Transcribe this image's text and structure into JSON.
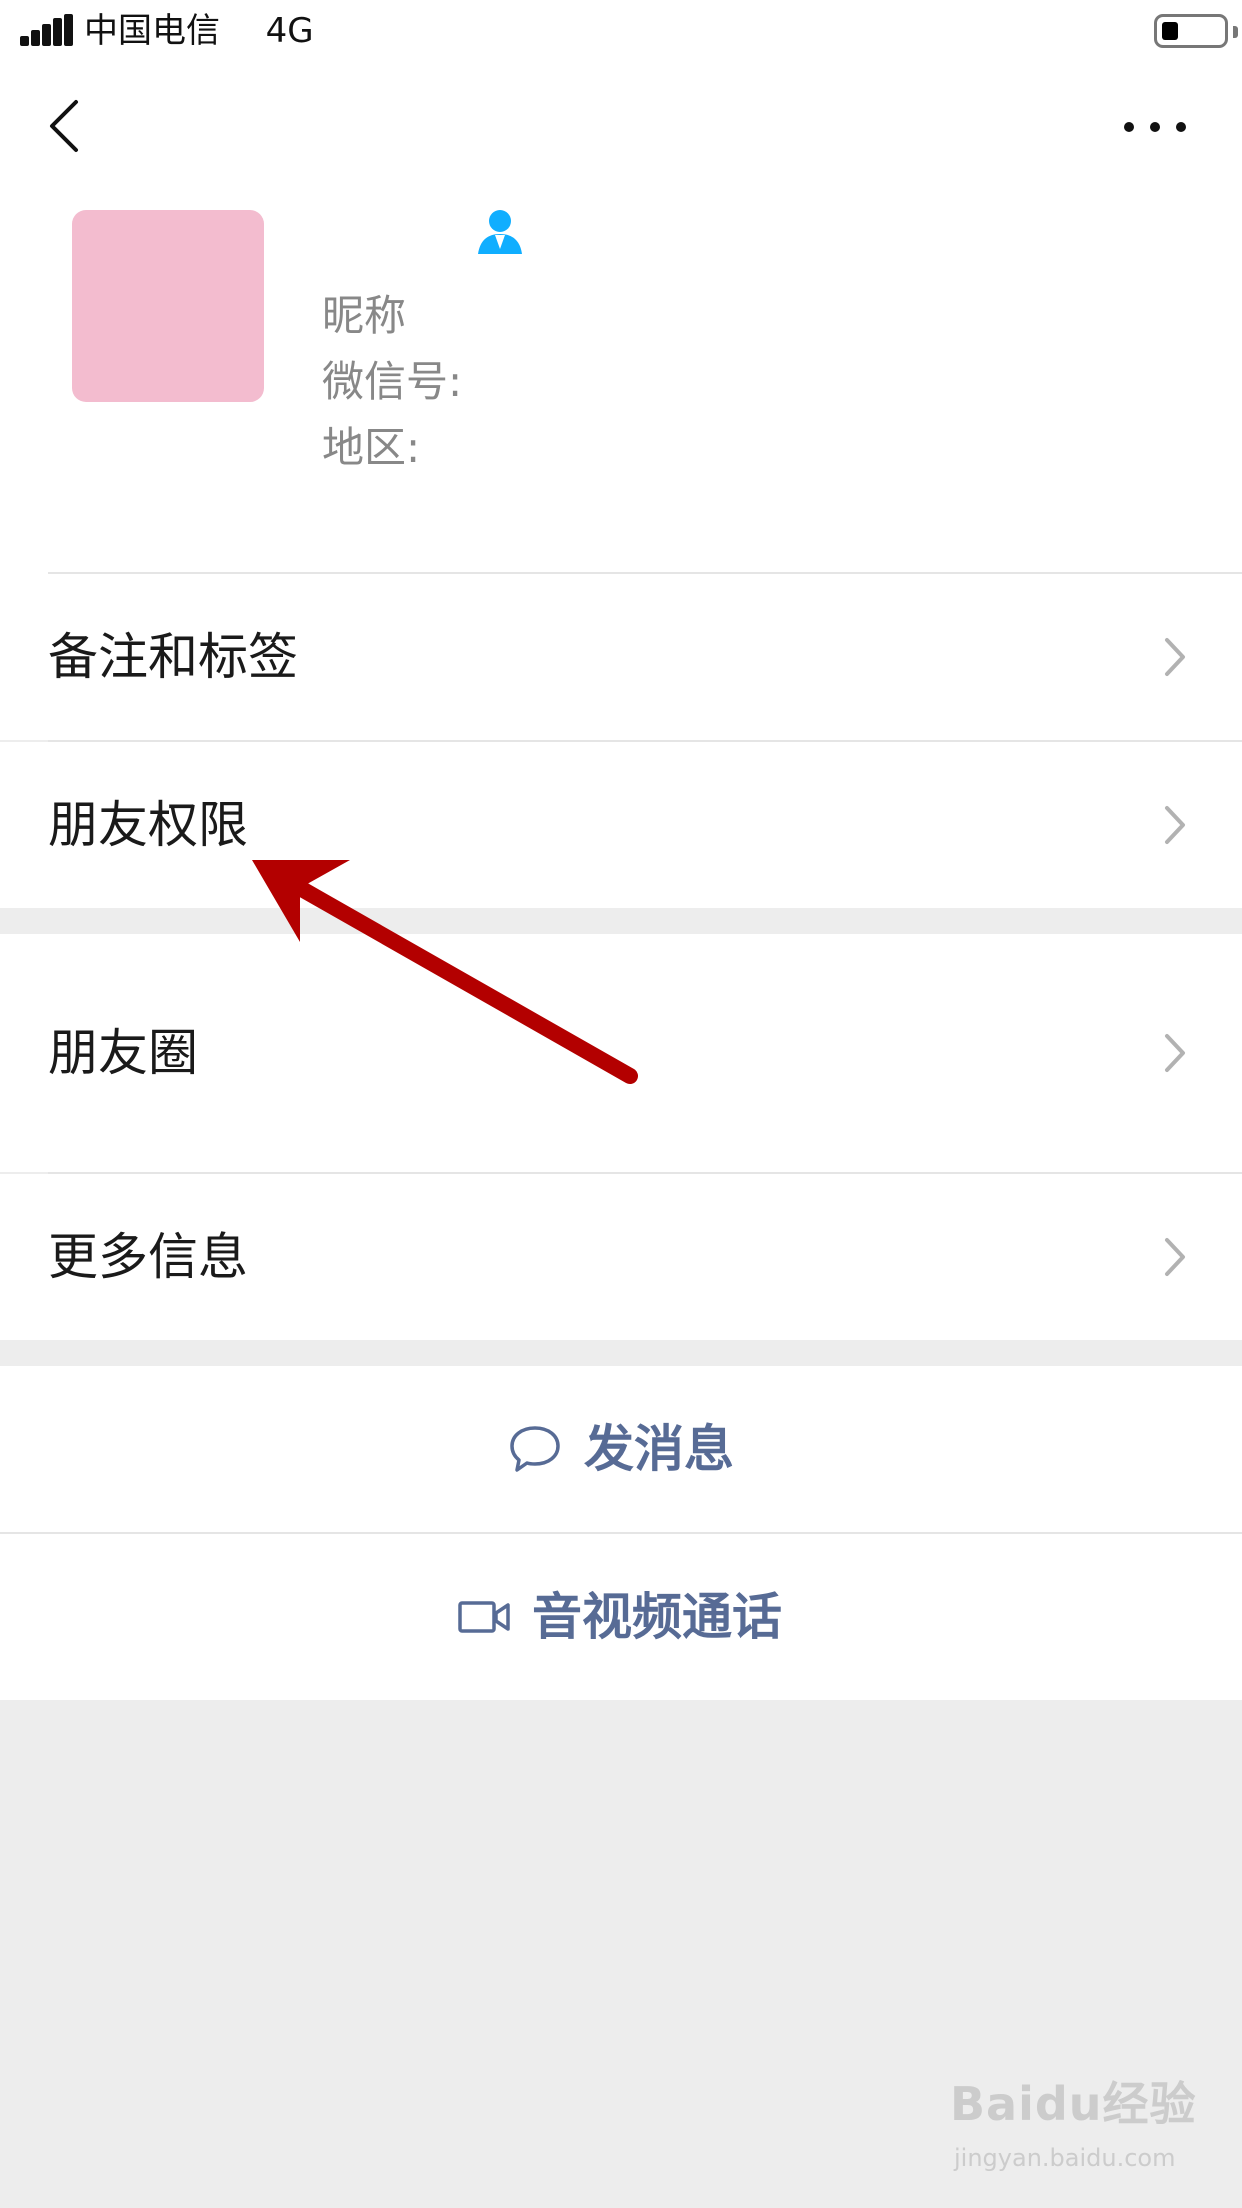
{
  "status_bar": {
    "carrier": "中国电信",
    "network": "4G",
    "battery_level": 0.25
  },
  "nav": {
    "back_icon": "chevron-left-icon",
    "more_icon": "ellipsis-icon"
  },
  "profile": {
    "avatar_color": "#f3bccf",
    "badge_icon": "contact-person-icon",
    "nickname_label": "昵称",
    "wechat_id_label": "微信号:",
    "region_label": "地区:"
  },
  "menu": {
    "notes_tags": "备注和标签",
    "friend_permissions": "朋友权限",
    "moments": "朋友圈",
    "more_info": "更多信息"
  },
  "actions": {
    "send_message": "发消息",
    "video_call": "音视频通话"
  },
  "watermark": {
    "brand": "Baidu经验",
    "url": "jingyan.baidu.com"
  },
  "colors": {
    "link_blue": "#576b95",
    "badge_blue": "#10aeff",
    "arrow_red": "#b30000",
    "background": "#ededed"
  }
}
